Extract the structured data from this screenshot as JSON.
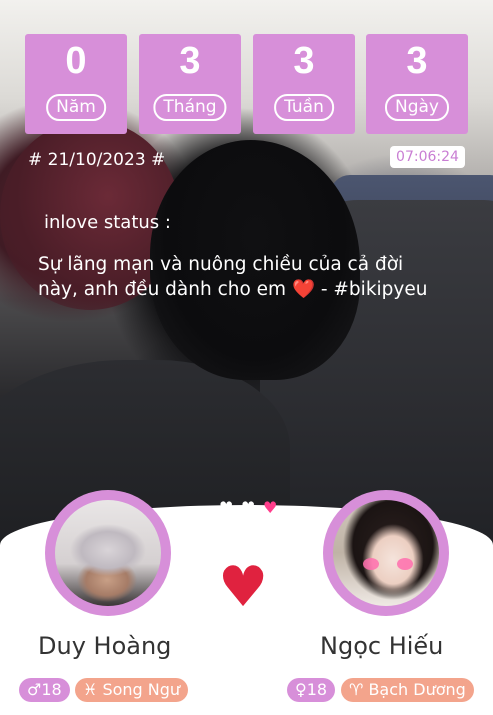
{
  "counter": {
    "years": {
      "value": "0",
      "label": "Năm"
    },
    "months": {
      "value": "3",
      "label": "Tháng"
    },
    "weeks": {
      "value": "3",
      "label": "Tuần"
    },
    "days": {
      "value": "3",
      "label": "Ngày"
    }
  },
  "start_date": "# 21/10/2023 #",
  "clock": "07:06:24",
  "status": {
    "title": "inlove status :",
    "text": "Sự lãng mạn và nuông chiều của cả đời này, anh đều dành cho em ❤️ - #bikipyeu"
  },
  "hearts": [
    "♥",
    "♥",
    "♥"
  ],
  "left_person": {
    "name": "Duy Hoàng",
    "gender_symbol": "♂",
    "age": "18",
    "zodiac_symbol": "♓",
    "zodiac": "Song Ngư"
  },
  "right_person": {
    "name": "Ngọc Hiếu",
    "gender_symbol": "♀",
    "age": "18",
    "zodiac_symbol": "♈",
    "zodiac": "Bạch Dương"
  },
  "colors": {
    "accent": "#d78fd9",
    "heart": "#e0223f",
    "zodiac_badge": "#f3a48c"
  }
}
